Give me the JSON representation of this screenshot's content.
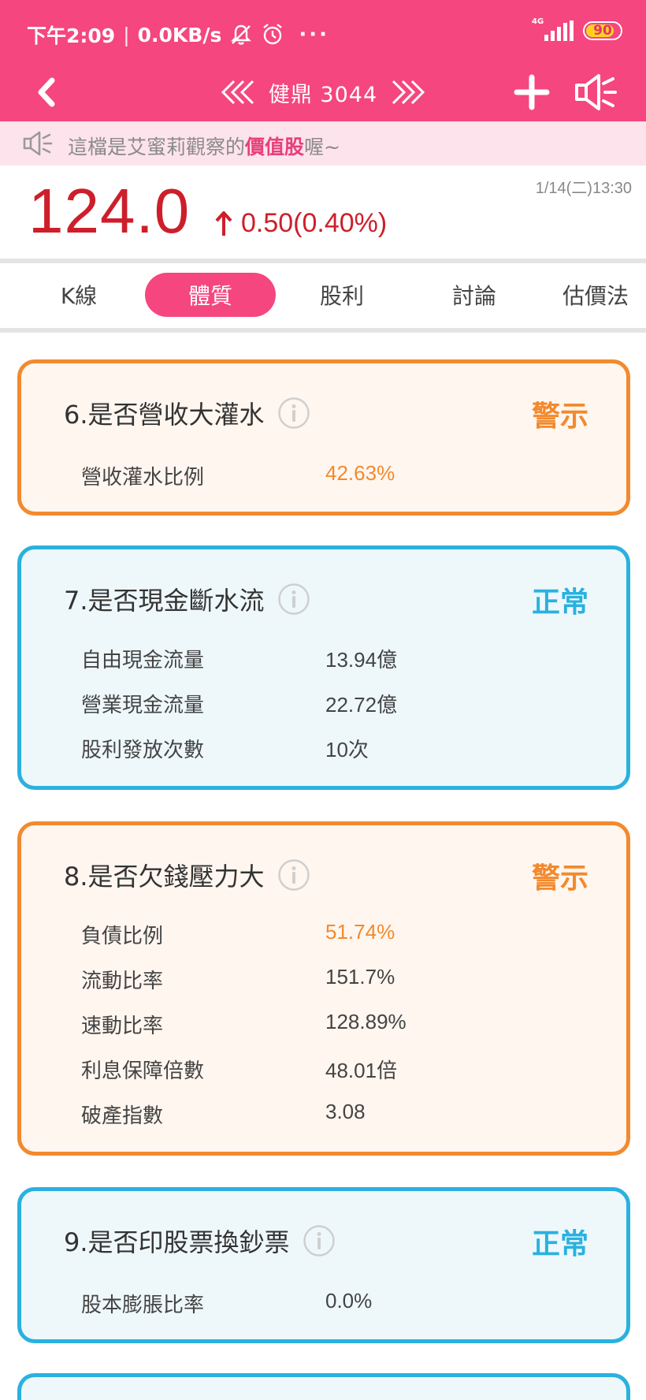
{
  "status_bar": {
    "time": "下午2:09",
    "speed": "0.0KB/s",
    "network": "4G",
    "battery": "90"
  },
  "nav": {
    "stock_name": "健鼎 3044"
  },
  "banner": {
    "prefix": "這檔是艾蜜莉觀察的",
    "highlight": "價值股",
    "suffix": "喔~"
  },
  "quote": {
    "price": "124.0",
    "change": "0.50(0.40%)",
    "datetime": "1/14(二)13:30"
  },
  "tabs": [
    {
      "label": "K線"
    },
    {
      "label": "體質"
    },
    {
      "label": "股利"
    },
    {
      "label": "討論"
    },
    {
      "label": "估價法"
    }
  ],
  "cards": [
    {
      "title": "6.是否營收大灌水",
      "status": "警示",
      "rows": [
        {
          "label": "營收灌水比例",
          "value": "42.63%"
        }
      ]
    },
    {
      "title": "7.是否現金斷水流",
      "status": "正常",
      "rows": [
        {
          "label": "自由現金流量",
          "value": "13.94億"
        },
        {
          "label": "營業現金流量",
          "value": "22.72億"
        },
        {
          "label": "股利發放次數",
          "value": "10次"
        }
      ]
    },
    {
      "title": "8.是否欠錢壓力大",
      "status": "警示",
      "rows": [
        {
          "label": "負債比例",
          "value": "51.74%"
        },
        {
          "label": "流動比率",
          "value": "151.7%"
        },
        {
          "label": "速動比率",
          "value": "128.89%"
        },
        {
          "label": "利息保障倍數",
          "value": "48.01倍"
        },
        {
          "label": "破產指數",
          "value": "3.08"
        }
      ]
    },
    {
      "title": "9.是否印股票換鈔票",
      "status": "正常",
      "rows": [
        {
          "label": "股本膨脹比率",
          "value": "0.0%"
        }
      ]
    }
  ],
  "colors": {
    "brand": "#f5467f",
    "price_up": "#cd1f2b",
    "warn": "#f28a2e",
    "ok": "#2ab1df"
  },
  "icons": [
    "bell-off-icon",
    "alarm-clock-icon",
    "more-dots-icon",
    "signal-icon",
    "battery-icon",
    "back-arrow-icon",
    "double-chevron-left-icon",
    "double-chevron-right-icon",
    "plus-icon",
    "speaker-icon",
    "up-arrow-icon",
    "info-icon"
  ]
}
